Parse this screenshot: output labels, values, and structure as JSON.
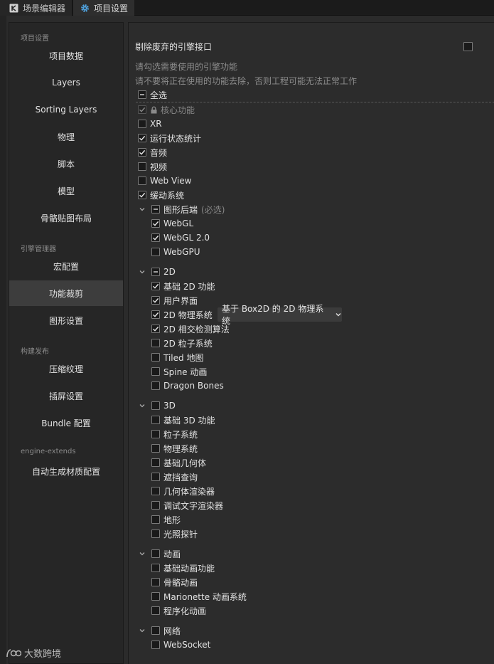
{
  "tabs": [
    {
      "label": "场景编辑器",
      "icon": "scene-editor-icon"
    },
    {
      "label": "项目设置",
      "icon": "gear-icon"
    }
  ],
  "sidebar": {
    "sections": [
      "项目设置",
      "引擎管理器",
      "构建发布",
      "engine-extends"
    ],
    "items": [
      "项目数据",
      "Layers",
      "Sorting Layers",
      "物理",
      "脚本",
      "模型",
      "骨骼贴图布局",
      "宏配置",
      "功能裁剪",
      "图形设置",
      "压缩纹理",
      "插屏设置",
      "Bundle 配置",
      "自动生成材质配置"
    ],
    "active": "功能裁剪"
  },
  "main": {
    "remove_deprecated_label": "剔除废弃的引擎接口",
    "remove_deprecated_checked": false,
    "help1": "请勾选需要使用的引擎功能",
    "help2": "请不要将正在使用的功能去除，否则工程可能无法正常工作",
    "select_all": "全选",
    "core": "核心功能",
    "xr": "XR",
    "runtime_stats": "运行状态统计",
    "audio": "音频",
    "video": "视频",
    "webview": "Web View",
    "tween": "缓动系统",
    "gfx_group": "图形后端",
    "gfx_required": "(必选)",
    "webgl": "WebGL",
    "webgl2": "WebGL 2.0",
    "webgpu": "WebGPU",
    "group_2d": "2D",
    "basic2d": "基础 2D 功能",
    "ui": "用户界面",
    "physics2d": "2D 物理系统",
    "physics2d_select": "基于 Box2D 的 2D 物理系统",
    "intersection2d": "2D 相交检测算法",
    "particle2d": "2D 粒子系统",
    "tiled": "Tiled 地图",
    "spine": "Spine 动画",
    "dragonbones": "Dragon Bones",
    "group_3d": "3D",
    "basic3d": "基础 3D 功能",
    "particle": "粒子系统",
    "physics": "物理系统",
    "primitive": "基础几何体",
    "occlusion": "遮挡查询",
    "geometry_renderer": "几何体渲染器",
    "debug_text": "调试文字渲染器",
    "terrain": "地形",
    "light_probe": "光照探针",
    "group_anim": "动画",
    "basic_anim": "基础动画功能",
    "skeletal": "骨骼动画",
    "marionette": "Marionette 动画系统",
    "procedural": "程序化动画",
    "group_net": "网络",
    "websocket": "WebSocket"
  },
  "watermark": "大数跨境",
  "colors": {
    "accent": "#3d3d3d",
    "checkmark": "#e8e8e8",
    "tab_icon": "#4fa3e0"
  }
}
